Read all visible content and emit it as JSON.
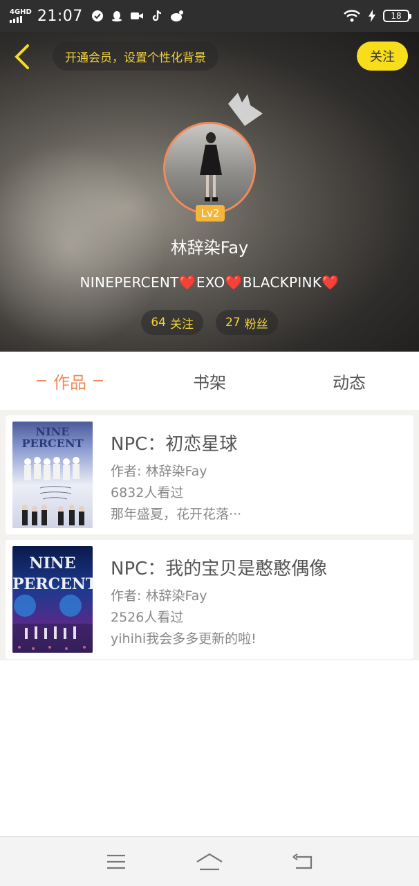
{
  "status_bar": {
    "network": "4GHD",
    "time": "21:07",
    "battery": "18",
    "icons": [
      "clock-check-icon",
      "qq-icon",
      "video-icon",
      "tiktok-icon",
      "weibo-icon"
    ],
    "right_icons": [
      "wifi-icon",
      "charging-icon",
      "battery-icon"
    ]
  },
  "header": {
    "vip_prompt": "开通会员，设置个性化背景",
    "follow_label": "关注",
    "level_badge": "Lv2",
    "nickname": "林辞染Fay",
    "bio": "NINEPERCENT❤️EXO❤️BLACKPINK❤️",
    "following_count": "64",
    "following_label": "关注",
    "followers_count": "27",
    "followers_label": "粉丝"
  },
  "tabs": [
    {
      "label": "作品",
      "active": true
    },
    {
      "label": "书架",
      "active": false
    },
    {
      "label": "动态",
      "active": false
    }
  ],
  "works": [
    {
      "title": "NPC：初恋星球",
      "author": "作者: 林辞染Fay",
      "views": "6832人看过",
      "summary": "那年盛夏，花开花落···",
      "cover_text": "NINE PERCENT"
    },
    {
      "title": "NPC：我的宝贝是憨憨偶像",
      "author": "作者: 林辞染Fay",
      "views": "2526人看过",
      "summary": "yihihi我会多多更新的啦!",
      "cover_text": "NINE PERCENT"
    }
  ],
  "colors": {
    "accent": "#f08a5a",
    "follow_yellow": "#f7dd1c",
    "pill_text": "#f4d338"
  }
}
